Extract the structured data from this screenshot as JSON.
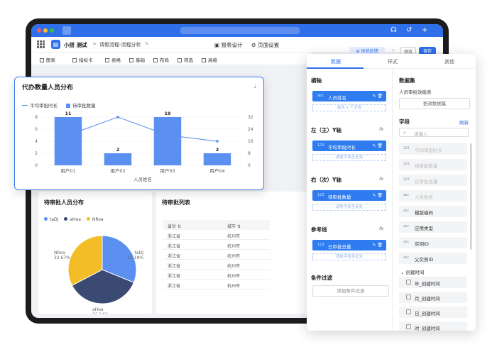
{
  "header": {
    "app_name": "小搭 测试",
    "breadcrumb_sep": ">",
    "flow_name": "请假流程-流程分析",
    "tabs": [
      {
        "label": "报表设计",
        "active": true
      },
      {
        "label": "页面设置",
        "active": false
      }
    ],
    "feedback_label": "体验反馈",
    "preview_label": "预览",
    "save_label": "保存"
  },
  "toolbar": {
    "items": [
      "图表",
      "指标卡",
      "表格",
      "基础",
      "布局",
      "筛选",
      "高级"
    ]
  },
  "chart_card": {
    "title": "代办数量人员分布",
    "chart_data": {
      "type": "bar+line",
      "categories": [
        "用户01",
        "用户02",
        "用户03",
        "用户04"
      ],
      "xlabel": "人员姓名",
      "series": [
        {
          "name": "平均审批时长",
          "type": "line",
          "axis": "right",
          "values": [
            20,
            32,
            20,
            16
          ]
        },
        {
          "name": "待审批数量",
          "type": "bar",
          "axis": "left",
          "values": [
            11,
            2,
            19,
            2
          ]
        }
      ],
      "left_axis": {
        "ticks": [
          0,
          2,
          4,
          6,
          8
        ],
        "range": [
          0,
          8
        ]
      },
      "right_axis": {
        "ticks": [
          0,
          8,
          16,
          24,
          32
        ],
        "range": [
          0,
          32
        ]
      },
      "bar_labels": [
        "11",
        "2",
        "19",
        "2"
      ],
      "colors": {
        "bar": "#5b8ff0",
        "line": "#5b8ff0"
      }
    }
  },
  "pie_card": {
    "title": "待审批人员分布",
    "chart_data": {
      "type": "pie",
      "slices": [
        {
          "name": "taDJ",
          "value": 31.19,
          "color": "#5b8ff0"
        },
        {
          "name": "aHea",
          "value": 36.14,
          "color": "#3a4a73"
        },
        {
          "name": "NRoa",
          "value": 32.67,
          "color": "#f2bd27"
        }
      ],
      "labels": [
        {
          "name": "taDJ",
          "pct": "31.19%"
        },
        {
          "name": "NRoa",
          "pct": "32.67%"
        },
        {
          "name": "aHea",
          "pct": "36.14%"
        }
      ]
    }
  },
  "table_card": {
    "title": "待审批列表",
    "columns": [
      "省份",
      "城市"
    ],
    "rows": [
      [
        "浙江省",
        "杭州市"
      ],
      [
        "浙江省",
        "杭州市"
      ],
      [
        "浙江省",
        "杭州市"
      ],
      [
        "浙江省",
        "杭州市"
      ],
      [
        "浙江省",
        "杭州市"
      ],
      [
        "浙江省",
        "杭州市"
      ]
    ]
  },
  "panel": {
    "tabs": [
      {
        "label": "数据",
        "active": true
      },
      {
        "label": "样式",
        "active": false
      },
      {
        "label": "其他",
        "active": false
      }
    ],
    "sections": {
      "x_axis": {
        "title": "横轴",
        "chip": "人员姓名",
        "chip_type": "abc",
        "hint": "最多 1 个字段"
      },
      "left_y": {
        "title": "左（主）Y轴",
        "chip": "平均审批时长",
        "chip_type": "123",
        "hint": "请拖字段至此处",
        "fx": "fx"
      },
      "right_y": {
        "title": "右（次）Y轴",
        "chip": "待审批数量",
        "chip_type": "123",
        "hint": "请拖字段至此处",
        "fx": "fx"
      },
      "ref_line": {
        "title": "参考线",
        "chip": "已审批总量",
        "chip_type": "123",
        "hint": "请拖字段至此处",
        "fx": "fx"
      },
      "filter": {
        "title": "条件过滤",
        "button": "添加条件过滤"
      }
    },
    "dataset": {
      "title": "数据集",
      "name": "人员审批效能表",
      "change_button": "更改数据集"
    },
    "fields": {
      "title": "字段",
      "refresh": "刷新",
      "search_placeholder": "请输入",
      "items": [
        {
          "type": "123",
          "label": "平均审批时长",
          "muted": true
        },
        {
          "type": "123",
          "label": "待审批数量",
          "muted": true
        },
        {
          "type": "123",
          "label": "已审批总量",
          "muted": true
        },
        {
          "type": "abc",
          "label": "人员姓名",
          "muted": true
        },
        {
          "type": "abc",
          "label": "模版编码",
          "muted": false
        },
        {
          "type": "abc",
          "label": "应用类型",
          "muted": false
        },
        {
          "type": "abc",
          "label": "实例ID",
          "muted": false
        },
        {
          "type": "abc",
          "label": "父实例ID",
          "muted": false
        }
      ],
      "folder": "创建时间",
      "date_items": [
        "年_创建时间",
        "月_创建时间",
        "日_创建时间",
        "时_创建时间"
      ]
    }
  }
}
